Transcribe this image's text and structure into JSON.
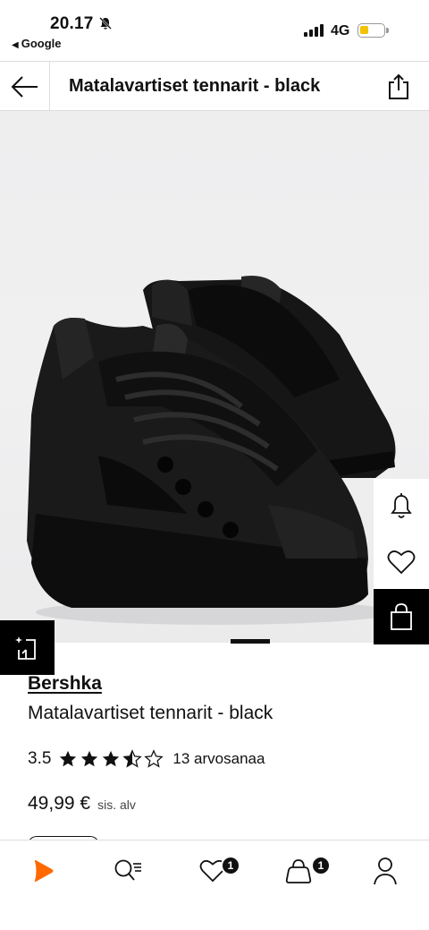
{
  "status_bar": {
    "time": "20.17",
    "back_app": "Google",
    "network": "4G",
    "bell_icon": "bell-slash-icon",
    "signal_icon": "signal-bars-icon",
    "battery_icon": "battery-low-icon",
    "battery_color": "#f2c200"
  },
  "header": {
    "title": "Matalavartiset tennarit - black",
    "back_icon": "arrow-left-icon",
    "share_icon": "share-icon"
  },
  "gallery": {
    "image_alt": "shoe-image",
    "actions": {
      "notify_icon": "bell-icon",
      "wishlist_icon": "heart-icon",
      "cart_icon": "shopping-bag-icon",
      "compare_icon": "size-compare-icon"
    }
  },
  "product": {
    "brand": "Bershka",
    "name": "Matalavartiset tennarit - black",
    "rating": "3.5",
    "rating_fraction": 0.7,
    "rating_count": "13 arvosanaa",
    "price": "49,99 €",
    "vat_note": "sis. alv"
  },
  "bottom_nav": {
    "accent_color": "#ff6900",
    "items": [
      {
        "name": "home",
        "icon": "zalando-play-icon"
      },
      {
        "name": "search",
        "icon": "search-icon"
      },
      {
        "name": "wishlist",
        "icon": "heart-icon",
        "badge": "1"
      },
      {
        "name": "bag",
        "icon": "shopping-bag-icon",
        "badge": "1"
      },
      {
        "name": "profile",
        "icon": "person-icon"
      }
    ]
  }
}
